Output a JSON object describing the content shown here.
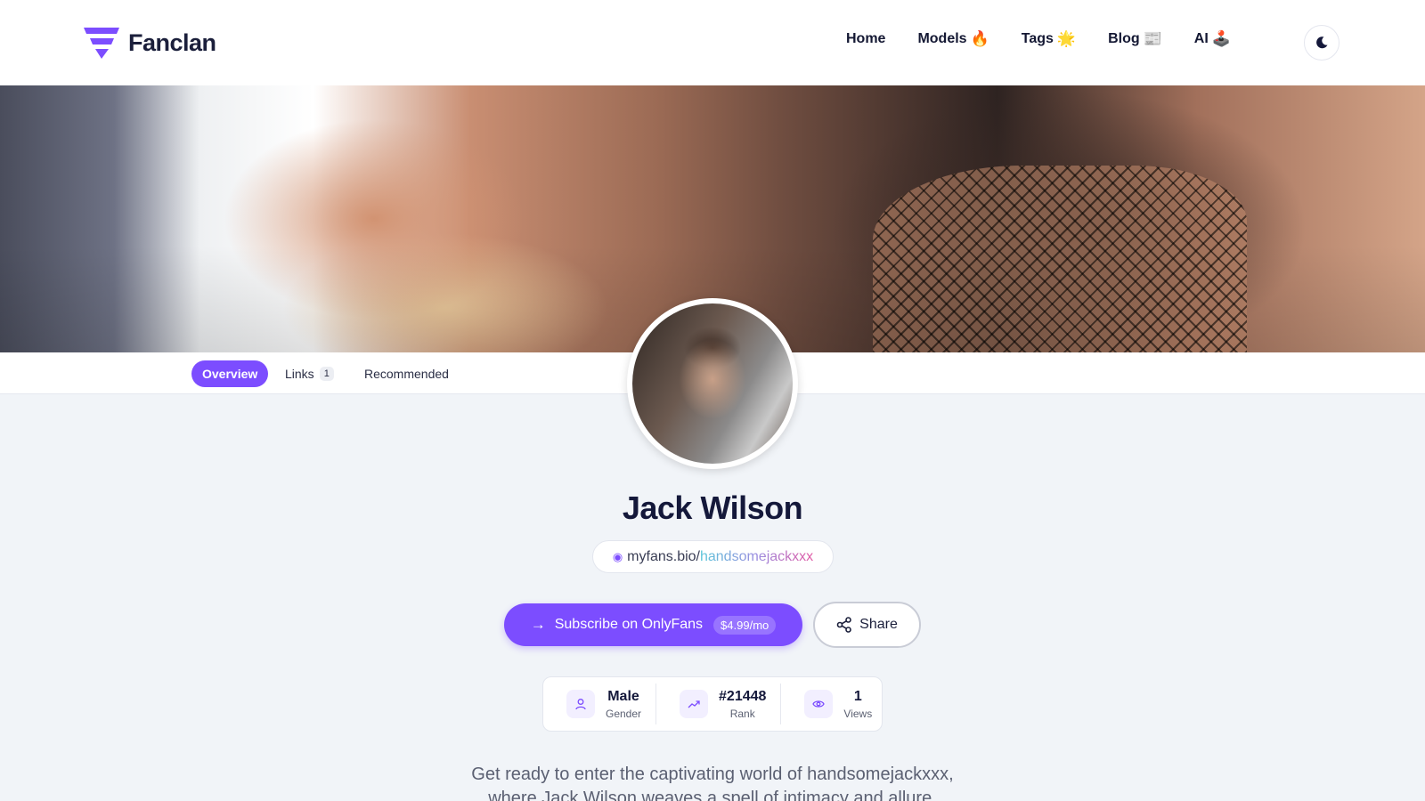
{
  "brand": {
    "name": "Fanclan",
    "accent_color": "#7c4dff"
  },
  "nav": {
    "items": [
      {
        "label": "Home",
        "icon": ""
      },
      {
        "label": "Models",
        "icon": "🔥"
      },
      {
        "label": "Tags",
        "icon": "🌟"
      },
      {
        "label": "Blog",
        "icon": "📰"
      },
      {
        "label": "AI",
        "icon": "🕹️"
      }
    ],
    "theme_toggle_icon": "moon-icon"
  },
  "tabs": [
    {
      "label": "Overview",
      "active": true
    },
    {
      "label": "Links",
      "count": "1"
    },
    {
      "label": "Recommended"
    }
  ],
  "profile": {
    "name": "Jack Wilson",
    "handle_prefix": "myfans.bio/",
    "handle_user": "handsomejackxxx",
    "subscribe_label": "Subscribe on OnlyFans",
    "price": "$4.99/mo",
    "share_label": "Share",
    "stats": [
      {
        "icon": "user-icon",
        "value": "Male",
        "label": "Gender"
      },
      {
        "icon": "trending-up-icon",
        "value": "#21448",
        "label": "Rank"
      },
      {
        "icon": "eye-icon",
        "value": "1",
        "label": "Views"
      }
    ],
    "bio": "Get ready to enter the captivating world of handsomejackxxx, where Jack Wilson weaves a spell of intimacy and allure."
  }
}
